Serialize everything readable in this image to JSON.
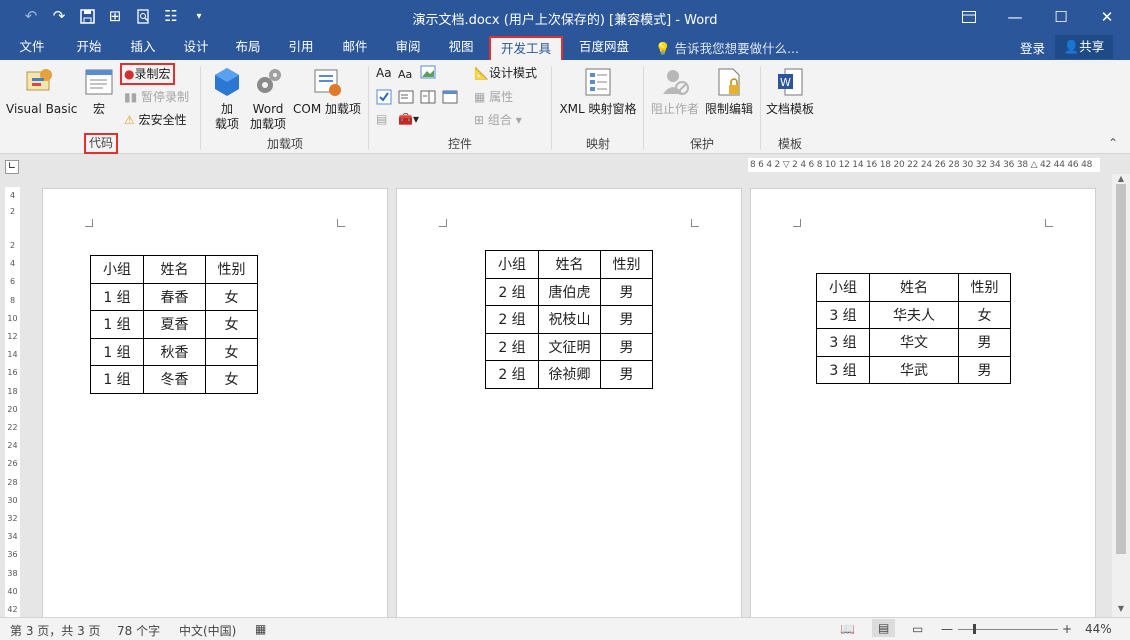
{
  "titlebar": {
    "title": "演示文档.docx (用户上次保存的) [兼容模式] - Word"
  },
  "tabs": [
    "文件",
    "开始",
    "插入",
    "设计",
    "布局",
    "引用",
    "邮件",
    "审阅",
    "视图",
    "开发工具",
    "百度网盘"
  ],
  "tellme": "告诉我您想要做什么...",
  "login": "登录",
  "share": "共享",
  "ribbon": {
    "visual_basic": "Visual Basic",
    "macros": "宏",
    "record_macro": "录制宏",
    "pause_recording": "暂停录制",
    "macro_security": "宏安全性",
    "group_code": "代码",
    "addins_l1": "加",
    "addins_l2": "载项",
    "word_addins_l1": "Word",
    "word_addins_l2": "加载项",
    "com_addins": "COM 加载项",
    "group_addins": "加载项",
    "design_mode": "设计模式",
    "properties": "属性",
    "group": "组合",
    "group_controls": "控件",
    "xml_pane": "XML 映射窗格",
    "group_mapping": "映射",
    "block_authors": "阻止作者",
    "restrict_editing": "限制编辑",
    "group_protect": "保护",
    "doc_template": "文档模板",
    "group_templates": "模板"
  },
  "ruler": {
    "horizontal": "8 6 4 2 ▽ 2 4 6 8 10 12 14 16 18 20 22 24 26 28 30 32 34 36 38 △ 42 44 46 48",
    "vertical": [
      "4",
      "2",
      "2",
      "4",
      "6",
      "8",
      "10",
      "12",
      "14",
      "16",
      "18",
      "20",
      "22",
      "24",
      "26",
      "28",
      "30",
      "32",
      "34",
      "36",
      "38",
      "40",
      "42"
    ]
  },
  "pages": [
    {
      "table": [
        [
          "小组",
          "姓名",
          "性别"
        ],
        [
          "1 组",
          "春香",
          "女"
        ],
        [
          "1 组",
          "夏香",
          "女"
        ],
        [
          "1 组",
          "秋香",
          "女"
        ],
        [
          "1 组",
          "冬香",
          "女"
        ]
      ]
    },
    {
      "table": [
        [
          "小组",
          "姓名",
          "性别"
        ],
        [
          "2 组",
          "唐伯虎",
          "男"
        ],
        [
          "2 组",
          "祝枝山",
          "男"
        ],
        [
          "2 组",
          "文征明",
          "男"
        ],
        [
          "2 组",
          "徐祯卿",
          "男"
        ]
      ]
    },
    {
      "table": [
        [
          "小组",
          "姓名",
          "性别"
        ],
        [
          "3 组",
          "华夫人",
          "女"
        ],
        [
          "3 组",
          "华文",
          "男"
        ],
        [
          "3 组",
          "华武",
          "男"
        ]
      ]
    }
  ],
  "status": {
    "page": "第 3 页，共 3 页",
    "words": "78 个字",
    "language": "中文(中国)",
    "zoom": "44%"
  },
  "colors": {
    "brand": "#2b579a",
    "highlight": "#e03030"
  }
}
